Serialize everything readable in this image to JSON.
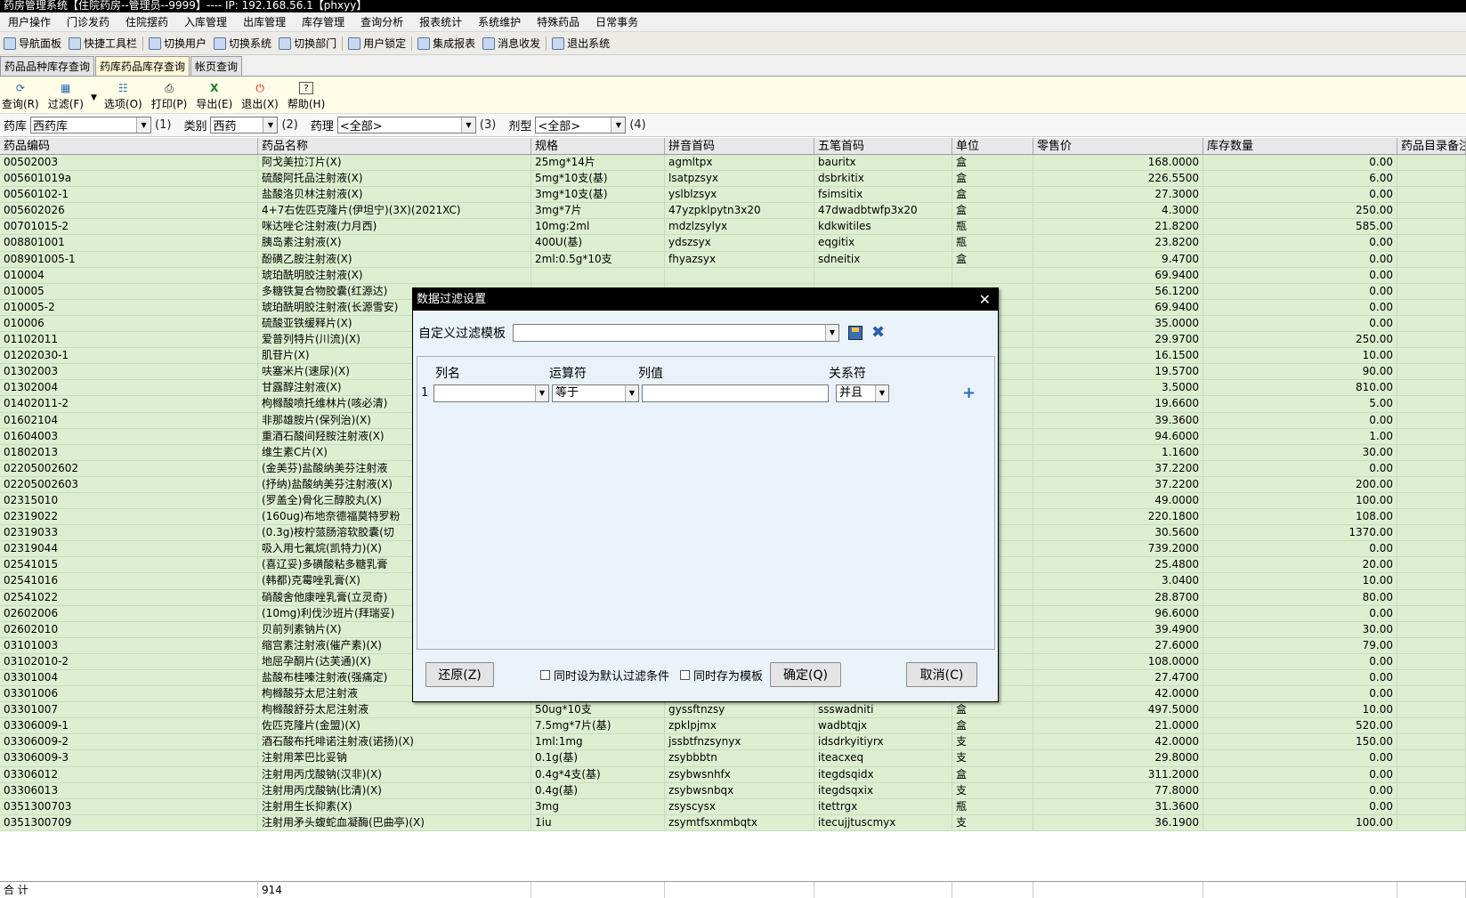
{
  "window": {
    "title": "药房管理系统【住院药房--管理员--9999】---- IP: 192.168.56.1【phxyy】"
  },
  "menu": [
    "用户操作",
    "门诊发药",
    "住院摆药",
    "入库管理",
    "出库管理",
    "库存管理",
    "查询分析",
    "报表统计",
    "系统维护",
    "特殊药品",
    "日常事务"
  ],
  "quickbar": [
    "导航面板",
    "快捷工具栏",
    "切换用户",
    "切换系统",
    "切换部门",
    "用户锁定",
    "集成报表",
    "消息收发",
    "退出系统"
  ],
  "tabs": [
    "药品品种库存查询",
    "药库药品库存查询",
    "帐页查询"
  ],
  "toolbar": {
    "query": "查询(R)",
    "filter": "过滤(F)",
    "options": "选项(O)",
    "print": "打印(P)",
    "export": "导出(E)",
    "exit": "退出(X)",
    "help": "帮助(H)"
  },
  "filter": {
    "l1": "药库",
    "v1": "西药库",
    "n1": "(1)",
    "l2": "类别",
    "v2": "西药",
    "n2": "(2)",
    "l3": "药理",
    "v3": "<全部>",
    "n3": "(3)",
    "l4": "剂型",
    "v4": "<全部>",
    "n4": "(4)"
  },
  "columns": [
    "药品编码",
    "药品名称",
    "规格",
    "拼音首码",
    "五笔首码",
    "单位",
    "零售价",
    "库存数量",
    "药品目录备注"
  ],
  "rows": [
    [
      "00502003",
      "阿戈美拉汀片(X)",
      "25mg*14片",
      "agmltpx",
      "bauritx",
      "盒",
      "168.0000",
      "0.00"
    ],
    [
      "005601019a",
      "硫酸阿托品注射液(X)",
      "5mg*10支(基)",
      "lsatpzsyx",
      "dsbrkitix",
      "盒",
      "226.5500",
      "6.00"
    ],
    [
      "00560102-1",
      "盐酸洛贝林注射液(X)",
      "3mg*10支(基)",
      "yslblzsyx",
      "fsimsitix",
      "盒",
      "27.3000",
      "0.00"
    ],
    [
      "005602026",
      "4+7右佐匹克隆片(伊坦宁)(3X)(2021XC)",
      "3mg*7片",
      "47yzpklpytn3x20",
      "47dwadbtwfp3x20",
      "盒",
      "4.3000",
      "250.00"
    ],
    [
      "00701015-2",
      "咪达唑仑注射液(力月西)",
      "10mg:2ml",
      "mdzlzsylyx",
      "kdkwitiles",
      "瓶",
      "21.8200",
      "585.00"
    ],
    [
      "008801001",
      "胰岛素注射液(X)",
      "400U(基)",
      "ydszsyx",
      "eqgitix",
      "瓶",
      "23.8200",
      "0.00"
    ],
    [
      "008901005-1",
      "酚磺乙胺注射液(X)",
      "2ml:0.5g*10支",
      "fhyazsyx",
      "sdneitix",
      "盒",
      "9.4700",
      "0.00"
    ],
    [
      "010004",
      "琥珀酰明胶注射液(X)",
      "",
      "",
      "",
      "",
      "69.9400",
      "0.00"
    ],
    [
      "010005",
      "多糖铁复合物胶囊(红源达)",
      "",
      "",
      "",
      "",
      "56.1200",
      "0.00"
    ],
    [
      "010005-2",
      "琥珀酰明胶注射液(长源雪安)",
      "",
      "",
      "",
      "",
      "69.9400",
      "0.00"
    ],
    [
      "010006",
      "硫酸亚铁缓释片(X)",
      "",
      "",
      "",
      "",
      "35.0000",
      "0.00"
    ],
    [
      "01102011",
      "爱普列特片(川流)(X)",
      "",
      "",
      "",
      "",
      "29.9700",
      "250.00"
    ],
    [
      "01202030-1",
      "肌苷片(X)",
      "",
      "",
      "",
      "",
      "16.1500",
      "10.00"
    ],
    [
      "01302003",
      "呋塞米片(速尿)(X)",
      "",
      "",
      "",
      "",
      "19.5700",
      "90.00"
    ],
    [
      "01302004",
      "甘露醇注射液(X)",
      "",
      "",
      "",
      "",
      "3.5000",
      "810.00"
    ],
    [
      "01402011-2",
      "枸橼酸喷托维林片(咳必清)",
      "",
      "",
      "",
      "",
      "19.6600",
      "5.00"
    ],
    [
      "01602104",
      "非那雄胺片(保列治)(X)",
      "",
      "",
      "",
      "",
      "39.3600",
      "0.00"
    ],
    [
      "01604003",
      "重酒石酸间羟胺注射液(X)",
      "",
      "",
      "",
      "",
      "94.6000",
      "1.00"
    ],
    [
      "01802013",
      "维生素C片(X)",
      "",
      "",
      "",
      "",
      "1.1600",
      "30.00"
    ],
    [
      "02205002602",
      "(金美芬)盐酸纳美芬注射液",
      "",
      "",
      "",
      "",
      "37.2200",
      "0.00"
    ],
    [
      "02205002603",
      "(抒纳)盐酸纳美芬注射液(X)",
      "",
      "",
      "",
      "",
      "37.2200",
      "200.00"
    ],
    [
      "02315010",
      "(罗盖全)骨化三醇胶丸(X)",
      "",
      "",
      "",
      "",
      "49.0000",
      "100.00"
    ],
    [
      "02319022",
      "(160ug)布地奈德福莫特罗粉",
      "",
      "",
      "",
      "",
      "220.1800",
      "108.00"
    ],
    [
      "02319033",
      "(0.3g)桉柠蒎肠溶软胶囊(切",
      "",
      "",
      "",
      "",
      "30.5600",
      "1370.00"
    ],
    [
      "02319044",
      "吸入用七氟烷(凯特力)(X)",
      "",
      "",
      "",
      "",
      "739.2000",
      "0.00"
    ],
    [
      "02541015",
      "(喜辽妥)多磺酸粘多糖乳膏",
      "",
      "",
      "",
      "",
      "25.4800",
      "20.00"
    ],
    [
      "02541016",
      "(韩都)克霉唑乳膏(X)",
      "",
      "",
      "",
      "",
      "3.0400",
      "10.00"
    ],
    [
      "02541022",
      "硝酸舍他康唑乳膏(立灵奇)",
      "",
      "",
      "",
      "",
      "28.8700",
      "80.00"
    ],
    [
      "02602006",
      "(10mg)利伐沙班片(拜瑞妥)",
      "",
      "",
      "",
      "",
      "96.6000",
      "0.00"
    ],
    [
      "02602010",
      "贝前列素钠片(X)",
      "",
      "",
      "",
      "",
      "39.4900",
      "30.00"
    ],
    [
      "03101003",
      "缩宫素注射液(催产素)(X)",
      "",
      "",
      "",
      "",
      "27.6000",
      "79.00"
    ],
    [
      "03102010-2",
      "地屈孕酮片(达芙通)(X)",
      "",
      "",
      "",
      "",
      "108.0000",
      "0.00"
    ],
    [
      "03301004",
      "盐酸布桂嗪注射液(强痛定)",
      "0.1g*10(基)",
      "ysbgqzsyqtd",
      "fsdskitixup",
      "盒",
      "27.4700",
      "0.00"
    ],
    [
      "03301006",
      "枸橼酸芬太尼注射液",
      "0.1mg*10(基)",
      "gysftnzsy",
      "sssadniti",
      "盒",
      "42.0000",
      "0.00"
    ],
    [
      "03301007",
      "枸橼酸舒芬太尼注射液",
      "50ug*10支",
      "gyssftnzsy",
      "ssswadniti",
      "盒",
      "497.5000",
      "10.00"
    ],
    [
      "03306009-1",
      "佐匹克隆片(金盟)(X)",
      "7.5mg*7片(基)",
      "zpklpjmx",
      "wadbtqjx",
      "盒",
      "21.0000",
      "520.00"
    ],
    [
      "03306009-2",
      "酒石酸布托啡诺注射液(诺扬)(X)",
      "1ml:1mg",
      "jssbtfnzsynyx",
      "idsdrkyitiyrx",
      "支",
      "42.0000",
      "150.00"
    ],
    [
      "03306009-3",
      "注射用苯巴比妥钠",
      "0.1g(基)",
      "zsybbbtn",
      "iteacxeq",
      "支",
      "29.8000",
      "0.00"
    ],
    [
      "03306012",
      "注射用丙戊酸钠(汉非)(X)",
      "0.4g*4支(基)",
      "zsybwsnhfx",
      "itegdsqidx",
      "盒",
      "311.2000",
      "0.00"
    ],
    [
      "03306013",
      "注射用丙戊酸钠(比清)(X)",
      "0.4g(基)",
      "zsybwsnbqx",
      "itegdsqxix",
      "支",
      "77.8000",
      "0.00"
    ],
    [
      "0351300703",
      "注射用生长抑素(X)",
      "3mg",
      "zsyscysx",
      "itettrgx",
      "瓶",
      "31.3600",
      "0.00"
    ],
    [
      "0351300709",
      "注射用矛头蝮蛇血凝酶(巴曲亭)(X)",
      "1iu",
      "zsymtfsxnmbqtx",
      "itecujjtuscmyx",
      "支",
      "36.1900",
      "100.00"
    ]
  ],
  "total": {
    "label": "合  计",
    "value": "914"
  },
  "dialog": {
    "title": "数据过滤设置",
    "template_label": "自定义过滤模板",
    "template_value": "",
    "col_name": "列名",
    "col_op": "运算符",
    "col_val": "列值",
    "col_rel": "关系符",
    "row_no": "1",
    "op_value": "等于",
    "rel_value": "并且",
    "restore": "还原(Z)",
    "chk_default": "同时设为默认过滤条件",
    "chk_save": "同时存为模板",
    "ok": "确定(Q)",
    "cancel": "取消(C)"
  }
}
